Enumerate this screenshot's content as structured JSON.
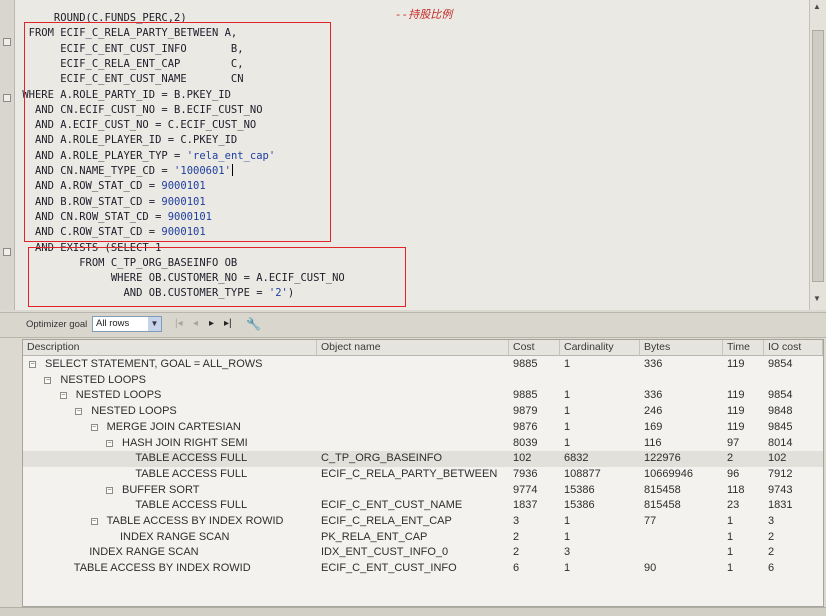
{
  "editor": {
    "comment": "--持股比例",
    "lines": [
      "      ROUND(C.FUNDS_PERC,2)",
      "  FROM ECIF_C_RELA_PARTY_BETWEEN A,",
      "       ECIF_C_ENT_CUST_INFO       B,",
      "       ECIF_C_RELA_ENT_CAP        C,",
      "       ECIF_C_ENT_CUST_NAME       CN",
      " WHERE A.ROLE_PARTY_ID = B.PKEY_ID",
      "   AND CN.ECIF_CUST_NO = B.ECIF_CUST_NO",
      "   AND A.ECIF_CUST_NO = C.ECIF_CUST_NO",
      "   AND A.ROLE_PLAYER_ID = C.PKEY_ID",
      "   AND A.ROLE_PLAYER_TYP = 'rela_ent_cap'",
      "   AND CN.NAME_TYPE_CD = '1000601'",
      "   AND A.ROW_STAT_CD = 9000101",
      "   AND B.ROW_STAT_CD = 9000101",
      "   AND CN.ROW_STAT_CD = 9000101",
      "   AND C.ROW_STAT_CD = 9000101",
      "   AND EXISTS (SELECT 1",
      "          FROM C_TP_ORG_BASEINFO OB",
      "               WHERE OB.CUSTOMER_NO = A.ECIF_CUST_NO",
      "                 AND OB.CUSTOMER_TYPE = '2')"
    ]
  },
  "toolbar": {
    "optimizer_label": "Optimizer goal",
    "optimizer_value": "All rows",
    "first_icon": "first-record-icon",
    "prev_icon": "prev-record-icon",
    "next_icon": "next-record-icon",
    "last_icon": "last-record-icon",
    "wrench_icon": "wrench-icon"
  },
  "plan": {
    "columns": [
      "Description",
      "Object name",
      "Cost",
      "Cardinality",
      "Bytes",
      "Time",
      "IO cost"
    ],
    "rows": [
      {
        "indent": 0,
        "toggle": true,
        "desc": "SELECT STATEMENT, GOAL = ALL_ROWS",
        "obj": "",
        "cost": "9885",
        "card": "1",
        "bytes": "336",
        "time": "119",
        "io": "9854"
      },
      {
        "indent": 1,
        "toggle": true,
        "desc": "NESTED LOOPS",
        "obj": "",
        "cost": "",
        "card": "",
        "bytes": "",
        "time": "",
        "io": ""
      },
      {
        "indent": 2,
        "toggle": true,
        "desc": "NESTED LOOPS",
        "obj": "",
        "cost": "9885",
        "card": "1",
        "bytes": "336",
        "time": "119",
        "io": "9854"
      },
      {
        "indent": 3,
        "toggle": true,
        "desc": "NESTED LOOPS",
        "obj": "",
        "cost": "9879",
        "card": "1",
        "bytes": "246",
        "time": "119",
        "io": "9848"
      },
      {
        "indent": 4,
        "toggle": true,
        "desc": "MERGE JOIN CARTESIAN",
        "obj": "",
        "cost": "9876",
        "card": "1",
        "bytes": "169",
        "time": "119",
        "io": "9845"
      },
      {
        "indent": 5,
        "toggle": true,
        "desc": "HASH JOIN RIGHT SEMI",
        "obj": "",
        "cost": "8039",
        "card": "1",
        "bytes": "116",
        "time": "97",
        "io": "8014"
      },
      {
        "indent": 6,
        "toggle": false,
        "desc": "TABLE ACCESS FULL",
        "obj": "C_TP_ORG_BASEINFO",
        "cost": "102",
        "card": "6832",
        "bytes": "122976",
        "time": "2",
        "io": "102",
        "sel": true
      },
      {
        "indent": 6,
        "toggle": false,
        "desc": "TABLE ACCESS FULL",
        "obj": "ECIF_C_RELA_PARTY_BETWEEN",
        "cost": "7936",
        "card": "108877",
        "bytes": "10669946",
        "time": "96",
        "io": "7912"
      },
      {
        "indent": 5,
        "toggle": true,
        "desc": "BUFFER SORT",
        "obj": "",
        "cost": "9774",
        "card": "15386",
        "bytes": "815458",
        "time": "118",
        "io": "9743"
      },
      {
        "indent": 6,
        "toggle": false,
        "desc": "TABLE ACCESS FULL",
        "obj": "ECIF_C_ENT_CUST_NAME",
        "cost": "1837",
        "card": "15386",
        "bytes": "815458",
        "time": "23",
        "io": "1831"
      },
      {
        "indent": 4,
        "toggle": true,
        "desc": "TABLE ACCESS BY INDEX ROWID",
        "obj": "ECIF_C_RELA_ENT_CAP",
        "cost": "3",
        "card": "1",
        "bytes": "77",
        "time": "1",
        "io": "3"
      },
      {
        "indent": 5,
        "toggle": false,
        "desc": "INDEX RANGE SCAN",
        "obj": "PK_RELA_ENT_CAP",
        "cost": "2",
        "card": "1",
        "bytes": "",
        "time": "1",
        "io": "2"
      },
      {
        "indent": 3,
        "toggle": false,
        "desc": "INDEX RANGE SCAN",
        "obj": "IDX_ENT_CUST_INFO_0",
        "cost": "2",
        "card": "3",
        "bytes": "",
        "time": "1",
        "io": "2"
      },
      {
        "indent": 2,
        "toggle": false,
        "desc": "TABLE ACCESS BY INDEX ROWID",
        "obj": "ECIF_C_ENT_CUST_INFO",
        "cost": "6",
        "card": "1",
        "bytes": "90",
        "time": "1",
        "io": "6"
      }
    ]
  }
}
